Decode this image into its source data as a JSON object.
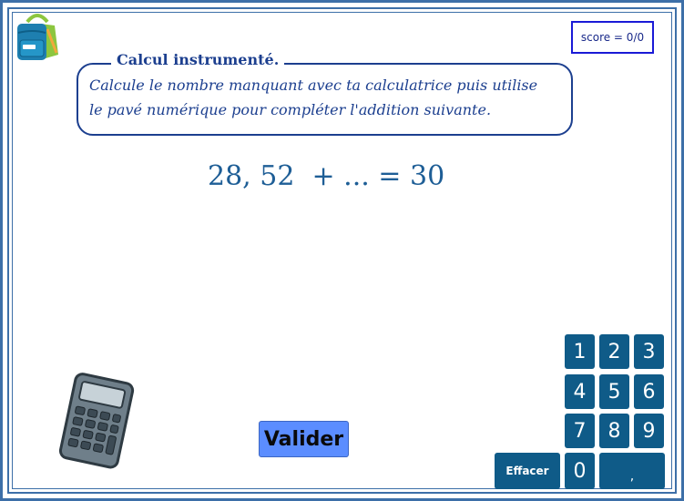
{
  "score": {
    "label": "score = 0/0"
  },
  "instructions": {
    "title": "Calcul instrumenté.",
    "line1": "Calcule le nombre manquant avec ta calculatrice puis utilise",
    "line2": "le pavé numérique pour compléter l'addition suivante."
  },
  "exercise": {
    "equation": "28, 52  + ... = 30"
  },
  "actions": {
    "validate_label": "Valider"
  },
  "keypad": {
    "keys": [
      "1",
      "2",
      "3",
      "4",
      "5",
      "6",
      "7",
      "8",
      "9"
    ],
    "zero": "0",
    "erase_label": "Effacer",
    "comma_label": ","
  },
  "colors": {
    "frame": "#3d6fa8",
    "title": "#1c3f8f",
    "equation": "#1e5e96",
    "keypad": "#0f5b88",
    "validate": "#5b8dff",
    "score_border": "#1a1ad6"
  },
  "icons": {
    "logo": "backpack-icon",
    "calculator": "calculator-icon"
  }
}
